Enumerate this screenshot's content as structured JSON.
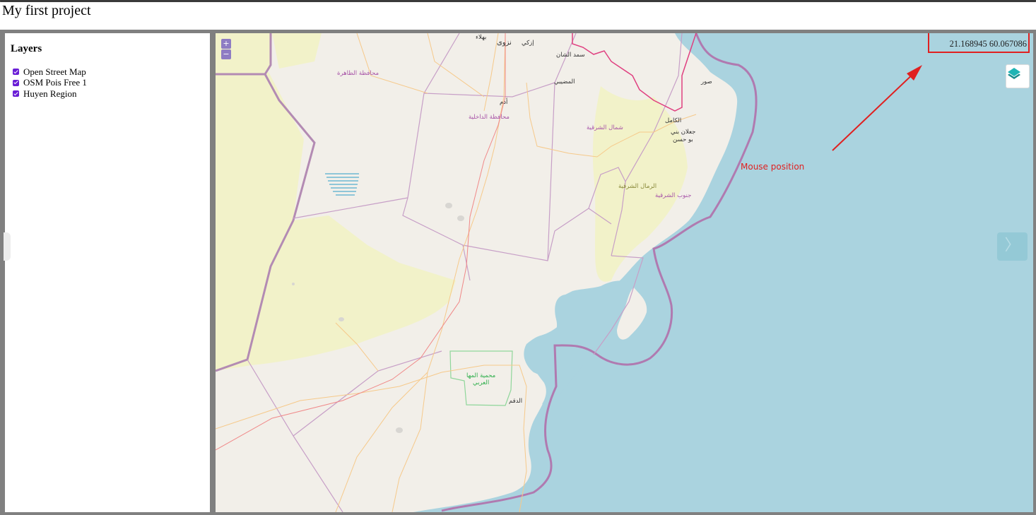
{
  "app": {
    "title": "My first project"
  },
  "sidebar": {
    "title": "Layers",
    "layers": [
      {
        "label": "Open Street Map",
        "checked": true
      },
      {
        "label": "OSM Pois Free 1",
        "checked": true
      },
      {
        "label": "Huyen Region",
        "checked": true
      }
    ]
  },
  "map": {
    "zoom_in": "+",
    "zoom_out": "−",
    "mouse_position": "21.168945 60.067086",
    "annotation": "Mouse position",
    "next_arrow": "〉",
    "colors": {
      "sea": "#aad3df",
      "land": "#f2efe9",
      "desert": "#f2f2c9",
      "admin_border": "#b38bb3",
      "coast_border": "#b07ab0",
      "highlight": "#e02020"
    },
    "places": [
      {
        "id": "p1",
        "label": "بهلاء"
      },
      {
        "id": "p2",
        "label": "نزوى"
      },
      {
        "id": "p3",
        "label": "إزكي"
      },
      {
        "id": "p4",
        "label": "سمد الشان"
      },
      {
        "id": "p5",
        "label": "محافظة الظاهرة"
      },
      {
        "id": "p6",
        "label": "المضيبي"
      },
      {
        "id": "p7",
        "label": "صور"
      },
      {
        "id": "p8",
        "label": "أدم"
      },
      {
        "id": "p9",
        "label": "محافظة الداخلية"
      },
      {
        "id": "p10",
        "label": "شمال الشرقية"
      },
      {
        "id": "p11",
        "label": "الكامل"
      },
      {
        "id": "p12",
        "label": "جعلان بني"
      },
      {
        "id": "p13",
        "label": "بو حسن"
      },
      {
        "id": "p14",
        "label": "الرمال الشرقية"
      },
      {
        "id": "p15",
        "label": "جنوب الشرقية"
      },
      {
        "id": "p16",
        "label": "محمية المها"
      },
      {
        "id": "p17",
        "label": "العربي"
      },
      {
        "id": "p18",
        "label": "الدقم"
      }
    ]
  }
}
